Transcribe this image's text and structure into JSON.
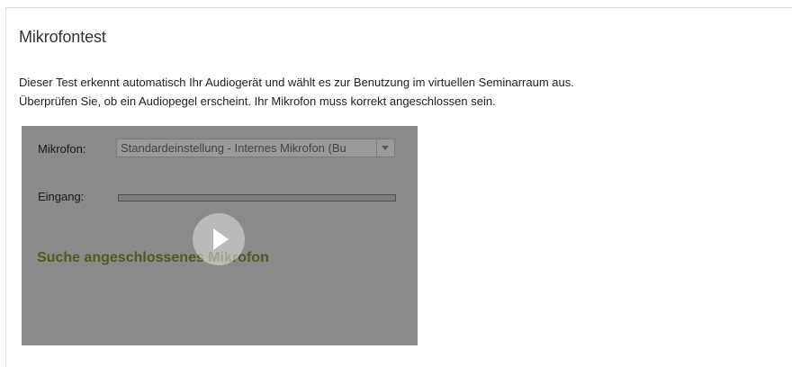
{
  "section": {
    "title": "Mikrofontest",
    "description_line1": "Dieser Test erkennt automatisch Ihr Audiogerät und wählt es zur Benutzung im virtuellen Seminarraum aus.",
    "description_line2": "Überprüfen Sie, ob ein Audiopegel erscheint. Ihr Mikrofon muss korrekt angeschlossen sein."
  },
  "mic_test": {
    "microphone_label": "Mikrofon:",
    "microphone_selected": "Standardeinstellung - Internes Mikrofon (Bu",
    "input_label": "Eingang:",
    "input_level": 0,
    "status_text": "Suche angeschlossenes Mikrofon",
    "play_icon": "play-icon"
  },
  "colors": {
    "panel_background": "#8a8a8a",
    "status_text": "#4a5e1c"
  }
}
